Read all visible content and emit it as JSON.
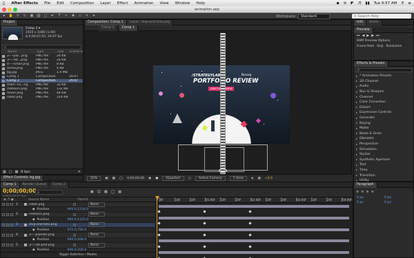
{
  "menubar": {
    "apple_icon": "apple-icon",
    "app_name": "After Effects",
    "items": [
      "File",
      "Edit",
      "Composition",
      "Layer",
      "Effect",
      "Animation",
      "View",
      "Window",
      "Help"
    ],
    "clock": "Tue 9:57 AM"
  },
  "window": {
    "title": "animation.aep"
  },
  "toolbar": {
    "workspace_label": "Workspace:",
    "workspace_value": "Standard",
    "search_placeholder": "Search Help"
  },
  "project": {
    "tab": "Project",
    "selected_name": "Comp 2 ▾",
    "selected_info1": "1920 x 1080 (1.00)",
    "selected_info2": "Δ 0;00;07;05, 29.97 fps",
    "search_placeholder": "ρ",
    "col_name": "Name",
    "col_type": "Type",
    "col_size": "Size",
    "col_frame": "Frame R",
    "items": [
      {
        "name": "2----pla...png",
        "type": "PNG file",
        "size": "24 KB",
        "fr": "",
        "kind": "file"
      },
      {
        "name": "3----rkt...png",
        "type": "PNG file",
        "size": "24 KB",
        "fr": "",
        "kind": "file"
      },
      {
        "name": "4----small.png",
        "type": "PNG file",
        "size": "8 KB",
        "fr": "",
        "kind": "file"
      },
      {
        "name": "arrow.png",
        "type": "PNG file",
        "size": "4 KB",
        "fr": "",
        "kind": "file"
      },
      {
        "name": "bg.jpg",
        "type": "JPEG",
        "size": "1.4 MB",
        "fr": "",
        "kind": "file"
      },
      {
        "name": "Comp 1",
        "type": "Composition",
        "size": "",
        "fr": "29.97",
        "kind": "comp"
      },
      {
        "name": "Comp 2",
        "type": "Composition",
        "size": "",
        "fr": "29.97",
        "kind": "comp",
        "selected": true
      },
      {
        "name": "main--co...ng",
        "type": "PNG file",
        "size": "32 KB",
        "fr": "",
        "kind": "file"
      },
      {
        "name": "meteors.png",
        "type": "PNG file",
        "size": "132 KB",
        "fr": "",
        "kind": "file"
      },
      {
        "name": "moon.png",
        "type": "PNG file",
        "size": "44 KB",
        "fr": "",
        "kind": "file"
      },
      {
        "name": "robot.png",
        "type": "PNG file",
        "size": "124 KB",
        "fr": "",
        "kind": "file"
      }
    ],
    "bpc": "8 bpc"
  },
  "effect_controls": {
    "tab": "Effect Controls: bg.jpg",
    "path": "Comp 1 • bg.jpg"
  },
  "composition": {
    "tab": "Composition: Comp 1",
    "layer_tab": "Layer: ship-and-tele.png",
    "subtabs": [
      "Comp 2",
      "Comp 1"
    ],
    "footer": {
      "zoom": "25%",
      "timecode": "0;00;00;00",
      "resolution": "(Quarter)",
      "camera": "Active Camera",
      "views": "1 View",
      "exposure": "+0.0"
    },
    "art_title_top": "/STRATEGYLABS",
    "art_title_main": "PORTFOLIO REVIEW",
    "art_title_tag": "Nisarg",
    "art_button": "JOIN THE REVIEW"
  },
  "info_panel": {
    "tabs": [
      "Info",
      "Audio"
    ],
    "preview_tab": "Preview",
    "ram_preview": "RAM Preview Options",
    "labels": [
      "Frame Rate",
      "Skip",
      "Resolution"
    ]
  },
  "effects_presets": {
    "tab": "Effects & Presets",
    "search_placeholder": "ρ",
    "items": [
      "* Animation Presets",
      "3D Channel",
      "Audio",
      "Blur & Sharpen",
      "Channel",
      "Color Correction",
      "Distort",
      "Expression Controls",
      "Generate",
      "Keying",
      "Matte",
      "Noise & Grain",
      "Obsolete",
      "Perspective",
      "Simulation",
      "Stylize",
      "Synthetic Aperture",
      "Text",
      "Time",
      "Transition",
      "Utility"
    ]
  },
  "paragraph": {
    "tab": "Paragraph",
    "values": [
      "0 px",
      "0 px",
      "0 px",
      "0 px"
    ]
  },
  "timeline": {
    "tabs": [
      "Comp 1",
      "Render Queue",
      "Comp 2"
    ],
    "timecode": "0;00;00;00",
    "fps_info": "00000 (29.97 fps)",
    "col_source": "Source Name",
    "col_parent": "Parent",
    "ruler": [
      "0f",
      "10f",
      "20f",
      "01:00f",
      "10f",
      "20f",
      "02:00f",
      "10f",
      "20f",
      "03:00f",
      "10f",
      "20f",
      "04:00f"
    ],
    "rows": [
      {
        "num": "1",
        "name": "robot.png",
        "parent": "None",
        "kind": "layer"
      },
      {
        "name": "Position",
        "value": "960.0,1234.0",
        "kind": "prop"
      },
      {
        "num": "2",
        "name": "meteors.png",
        "parent": "None",
        "kind": "layer"
      },
      {
        "name": "Position",
        "value": "960.0,1222.0",
        "kind": "prop"
      },
      {
        "num": "3",
        "name": "ship-and-tele.png",
        "parent": "None",
        "kind": "layer"
      },
      {
        "name": "Position",
        "value": "972.0,750.0",
        "kind": "prop"
      },
      {
        "num": "4",
        "name": "2----planets.png",
        "parent": "None",
        "kind": "layer"
      },
      {
        "name": "Position",
        "value": "960.0,498.0",
        "kind": "prop"
      },
      {
        "num": "5",
        "name": "3----rkt-plnt.png",
        "parent": "None",
        "kind": "layer"
      },
      {
        "name": "Position",
        "value": "946.0,356.0",
        "kind": "prop"
      }
    ],
    "footer": "Toggle Switches / Modes"
  }
}
